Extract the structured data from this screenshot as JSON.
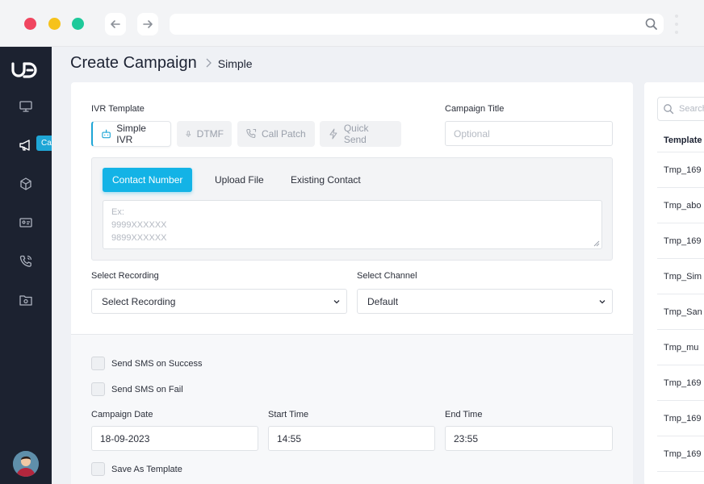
{
  "sidebar": {
    "tooltip": "Campaign"
  },
  "page": {
    "title": "Create Campaign",
    "subtitle": "Simple"
  },
  "form": {
    "ivr_template_label": "IVR Template",
    "ivr_options": [
      "Simple IVR",
      "DTMF",
      "Call Patch",
      "Quick Send"
    ],
    "campaign_title_label": "Campaign Title",
    "campaign_title_placeholder": "Optional",
    "contact_tabs": [
      "Contact Number",
      "Upload File",
      "Existing Contact"
    ],
    "contact_placeholder_lines": [
      "Ex:",
      "9999XXXXXX",
      "9899XXXXXX"
    ],
    "select_recording_label": "Select Recording",
    "select_recording_value": "Select Recording",
    "select_channel_label": "Select Channel",
    "select_channel_value": "Default",
    "send_sms_success": "Send SMS on Success",
    "send_sms_fail": "Send SMS on Fail",
    "campaign_date_label": "Campaign Date",
    "campaign_date_value": "18-09-2023",
    "start_time_label": "Start Time",
    "start_time_value": "14:55",
    "end_time_label": "End Time",
    "end_time_value": "23:55",
    "save_as_template": "Save As Template"
  },
  "templates": {
    "search_placeholder": "Search",
    "header": "Template",
    "rows": [
      "Tmp_169",
      "Tmp_abo",
      "Tmp_169",
      "Tmp_Sim",
      "Tmp_San",
      "Tmp_mu",
      "Tmp_169",
      "Tmp_169",
      "Tmp_169"
    ]
  }
}
